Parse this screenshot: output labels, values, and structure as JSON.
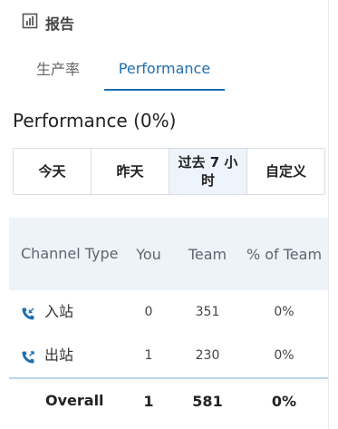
{
  "header": {
    "title": "报告",
    "icon": "bar-chart-icon"
  },
  "tabs": [
    {
      "label": "生产率",
      "active": false
    },
    {
      "label": "Performance",
      "active": true
    }
  ],
  "section_title": "Performance (0%)",
  "time_ranges": [
    {
      "label": "今天",
      "active": false
    },
    {
      "label": "昨天",
      "active": false
    },
    {
      "label": "过去 7 小时",
      "active": true
    },
    {
      "label": "自定义",
      "active": false
    }
  ],
  "table": {
    "columns": [
      "Channel Type",
      "You",
      "Team",
      "% of Team"
    ],
    "rows": [
      {
        "channel": "入站",
        "icon": "inbound-call-icon",
        "you": "0",
        "team": "351",
        "pct": "0%"
      },
      {
        "channel": "出站",
        "icon": "outbound-call-icon",
        "you": "1",
        "team": "230",
        "pct": "0%"
      }
    ],
    "overall": {
      "label": "Overall",
      "you": "1",
      "team": "581",
      "pct": "0%"
    }
  },
  "colors": {
    "accent": "#1f6fb0",
    "header_bg": "#eef3f8",
    "active_bg": "#edf4fb"
  }
}
